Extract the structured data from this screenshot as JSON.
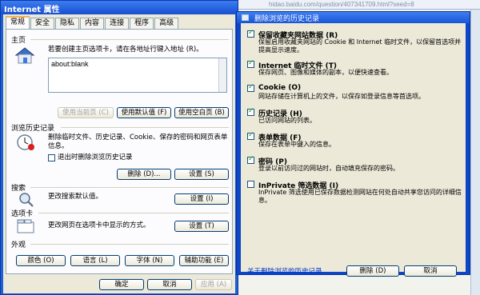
{
  "background": {
    "address_text": "hidao.baidu.com/question/407341709.html?seed=8"
  },
  "internet_options": {
    "title": "Internet 属性",
    "tabs": [
      "常规",
      "安全",
      "隐私",
      "内容",
      "连接",
      "程序",
      "高级"
    ],
    "homepage": {
      "group_label": "主页",
      "description": "若要创建主页选项卡，请在各地址行键入地址 (R)。",
      "url": "about:blank",
      "buttons": [
        "使用当前页 (C)",
        "使用默认值 (F)",
        "使用空白页 (B)"
      ]
    },
    "history": {
      "group_label": "浏览历史记录",
      "description": "删除临时文件、历史记录、Cookie、保存的密码和网页表单信息。",
      "checkbox_label": "退出时删除浏览历史记录",
      "buttons": [
        "删除 (D)...",
        "设置 (S)"
      ]
    },
    "search": {
      "group_label": "搜索",
      "description": "更改搜索默认值。",
      "button": "设置 (I)"
    },
    "tabs_group": {
      "group_label": "选项卡",
      "description": "更改网页在选项卡中显示的方式。",
      "button": "设置 (T)"
    },
    "appearance": {
      "group_label": "外观",
      "buttons": [
        "颜色 (O)",
        "语言 (L)",
        "字体 (N)",
        "辅助功能 (E)"
      ]
    },
    "bottom_buttons": [
      "确定",
      "取消",
      "应用 (A)"
    ]
  },
  "delete_dialog": {
    "title": "删除浏览的历史记录",
    "items": [
      {
        "title": "保留收藏夹网站数据 (R)",
        "description": "保留启用收藏夹网站的 Cookie 和 Internet 临时文件，以保留首选项并提高显示速度。",
        "checked": true
      },
      {
        "title": "Internet 临时文件 (T)",
        "description": "保存网页、图像和媒体的副本，以便快速查看。",
        "checked": true
      },
      {
        "title": "Cookie (O)",
        "description": "网站存储在计算机上的文件，以保存如登录信息等首选项。",
        "checked": true
      },
      {
        "title": "历史记录 (H)",
        "description": "已访问网站的列表。",
        "checked": true
      },
      {
        "title": "表单数据 (F)",
        "description": "保存在表单中键入的信息。",
        "checked": true
      },
      {
        "title": "密码 (P)",
        "description": "登录以前访问过的网站时，自动填充保存的密码。",
        "checked": true
      },
      {
        "title": "InPrivate 筛选数据 (I)",
        "description": "InPrivate 筛选使用已保存数据检测网站在何处自动共享您访问的详细信息。",
        "checked": false
      }
    ],
    "link": "关于删除浏览的历史记录",
    "buttons": [
      "删除 (D)",
      "取消"
    ]
  }
}
